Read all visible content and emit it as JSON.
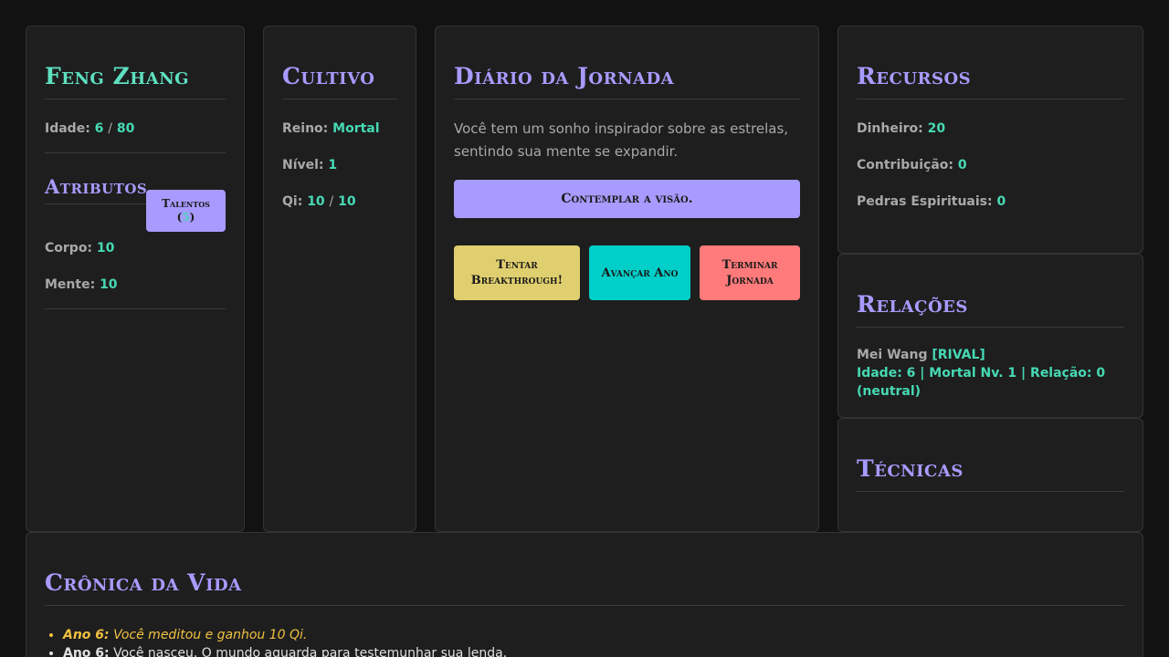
{
  "character": {
    "name": "Feng Zhang",
    "age_label": "Idade:",
    "age": "6",
    "age_sep": "/",
    "age_max": "80"
  },
  "attributes": {
    "title": "Atributos",
    "talents_label": "Talentos",
    "talents_count": "5",
    "items": [
      {
        "label": "Corpo:",
        "value": "10"
      },
      {
        "label": "Mente:",
        "value": "10"
      }
    ]
  },
  "cultivation": {
    "title": "Cultivo",
    "realm_label": "Reino:",
    "realm": "Mortal",
    "level_label": "Nível:",
    "level": "1",
    "qi_label": "Qi:",
    "qi": "10",
    "qi_sep": "/",
    "qi_max": "10"
  },
  "journal": {
    "title": "Diário da Jornada",
    "text": "Você tem um sonho inspirador sobre as estrelas, sentindo sua mente se expandir.",
    "choice_button": "Contemplar a visão.",
    "breakthrough_button": "Tentar Breakthrough!",
    "advance_button": "Avançar Ano",
    "end_button": "Terminar Jornada"
  },
  "resources": {
    "title": "Recursos",
    "items": [
      {
        "label": "Dinheiro:",
        "value": "20"
      },
      {
        "label": "Contribuição:",
        "value": "0"
      },
      {
        "label": "Pedras Espirituais:",
        "value": "0"
      }
    ]
  },
  "relations": {
    "title": "Relações",
    "items": [
      {
        "name": "Mei Wang",
        "tag": "[RIVAL]",
        "details": "Idade: 6 | Mortal Nv. 1 | Relação: 0 (neutral)"
      }
    ]
  },
  "techniques": {
    "title": "Técnicas"
  },
  "chronicle": {
    "title": "Crônica da Vida",
    "entries": [
      {
        "icon": "",
        "year": "Ano 6:",
        "text": "Você meditou e ganhou 10 Qi."
      },
      {
        "icon": "",
        "year": "Ano 6:",
        "text": "Você nasceu. O mundo aguarda para testemunhar sua lenda."
      }
    ]
  },
  "colors": {
    "accent": "#a79bff",
    "value": "#46d9b4",
    "name": "#5ee0c0",
    "highlight": "#f0c040",
    "yellow_button": "#e0cf6e",
    "teal_button": "#00cfc9",
    "red_button": "#ff7a7a"
  }
}
